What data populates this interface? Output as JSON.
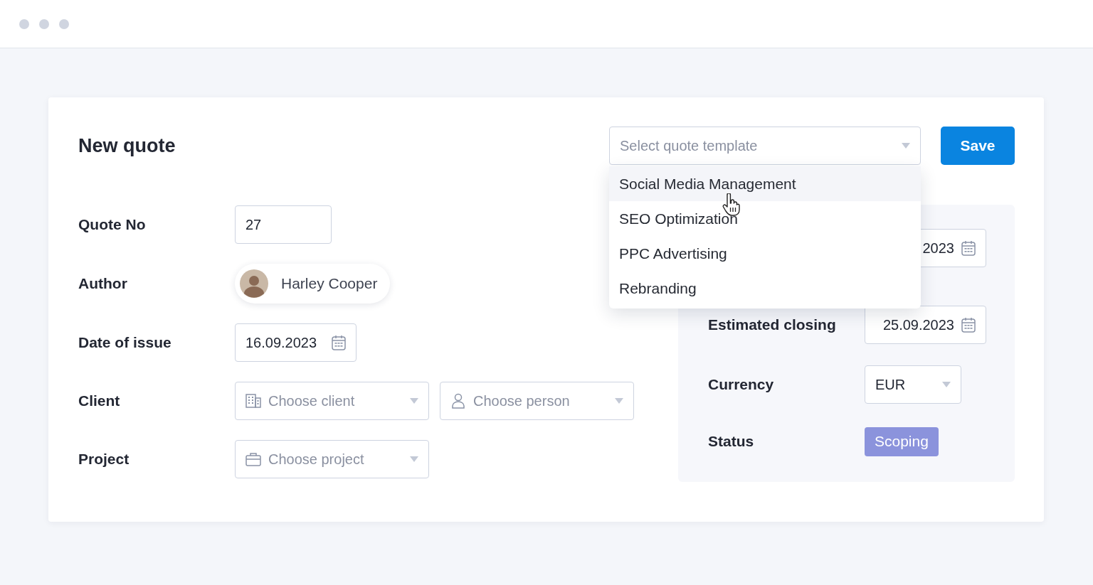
{
  "title": "New quote",
  "template_select": {
    "placeholder": "Select quote template",
    "expanded": true,
    "options": [
      {
        "label": "Social Media Management",
        "highlighted": true
      },
      {
        "label": "SEO Optimization",
        "highlighted": false
      },
      {
        "label": "PPC Advertising",
        "highlighted": false
      },
      {
        "label": "Rebranding",
        "highlighted": false
      }
    ]
  },
  "save_button": "Save",
  "fields": [
    {
      "kind": "text",
      "label": "Quote No",
      "value": "27"
    },
    {
      "kind": "person",
      "label": "Author",
      "value": "Harley Cooper"
    },
    {
      "kind": "date",
      "label": "Date of issue",
      "value": "16.09.2023"
    },
    {
      "kind": "selects",
      "label": "Client",
      "selects": [
        {
          "kind": "client",
          "placeholder": "Choose client"
        },
        {
          "kind": "person",
          "placeholder": "Choose person"
        }
      ]
    },
    {
      "kind": "selects",
      "label": "Project",
      "selects": [
        {
          "kind": "project",
          "placeholder": "Choose project"
        }
      ]
    }
  ],
  "details": [
    {
      "kind": "date",
      "value": "2023"
    },
    {
      "kind": "date",
      "label": "Estimated closing",
      "value": "25.09.2023"
    },
    {
      "kind": "select",
      "label": "Currency",
      "value": "EUR"
    },
    {
      "kind": "status",
      "label": "Status",
      "value": "Scoping"
    }
  ]
}
